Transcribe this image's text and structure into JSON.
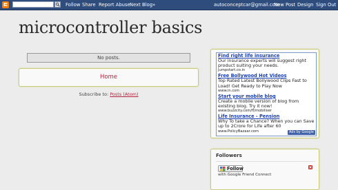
{
  "navbar": {
    "search_placeholder": "",
    "links": [
      "Follow",
      "Share",
      "Report Abuse",
      "Next Blog»"
    ],
    "email": "autoconceptcar@gmail.com",
    "actions": [
      "New Post",
      "Design",
      "Sign Out"
    ],
    "logo_icon": "blogger-logo-icon",
    "search_icon": "magnifier-icon"
  },
  "blog": {
    "title": "microcontroller basics"
  },
  "main": {
    "no_posts": "No posts.",
    "home_link": "Home",
    "subscribe_label": "Subscribe to:",
    "subscribe_link": "Posts (Atom)"
  },
  "ads": {
    "items": [
      {
        "title": "Find right life insurance",
        "body": "Our insurance experts will suggest right product suiting your needs.",
        "url": "Jumpstart.co.in"
      },
      {
        "title": "Free Bollywood Hot Videos",
        "body": "Top Rated Latest Bollywood Clips Fast to Load! Get Ready to Play Now",
        "url": "www.in.com"
      },
      {
        "title": "Start your mobile blog",
        "body": "Create a mobile version of blog from existing blog. Try it now!",
        "url": "www.buzzcity.com/fl/mobiliser"
      },
      {
        "title": "Life Insurance - Pension",
        "body": "Why To take a Chance? When you can Save up to 2Crore for Life after 60",
        "url": "www.PolicyBazaar.com"
      }
    ],
    "badge": "Ads by Google"
  },
  "followers": {
    "title": "Followers",
    "follow_button": "Follow",
    "gfc_text": "with Google Friend Connect"
  },
  "colors": {
    "navbar_bg": "#2f4d7c",
    "link_red": "#b3243c",
    "ad_link_blue": "#1a3fb0",
    "gadget_border": "#c9c97a",
    "page_bg": "#ececec"
  }
}
